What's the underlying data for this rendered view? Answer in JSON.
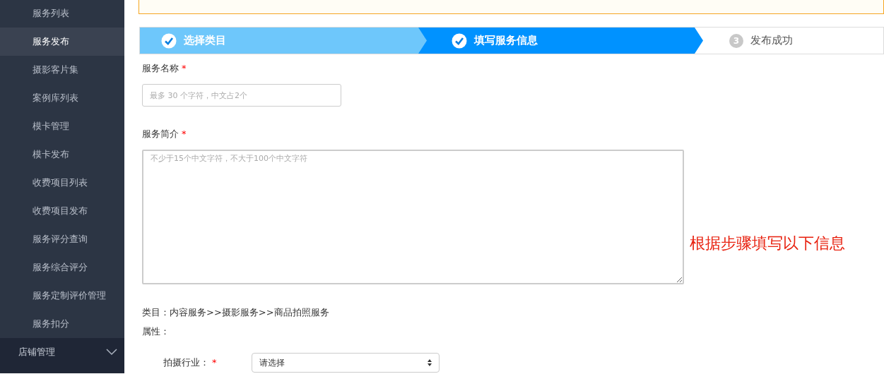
{
  "sidebar": {
    "items": [
      {
        "label": "服务列表",
        "selected": false
      },
      {
        "label": "服务发布",
        "selected": true
      },
      {
        "label": "摄影客片集",
        "selected": false
      },
      {
        "label": "案例库列表",
        "selected": false
      },
      {
        "label": "模卡管理",
        "selected": false
      },
      {
        "label": "模卡发布",
        "selected": false
      },
      {
        "label": "收费项目列表",
        "selected": false
      },
      {
        "label": "收费项目发布",
        "selected": false
      },
      {
        "label": "服务评分查询",
        "selected": false
      },
      {
        "label": "服务综合评分",
        "selected": false
      },
      {
        "label": "服务定制评价管理",
        "selected": false
      },
      {
        "label": "服务扣分",
        "selected": false
      }
    ],
    "groups": [
      {
        "label": "店铺管理",
        "expanded": false
      }
    ]
  },
  "steps": [
    {
      "label": "选择类目",
      "completed": true,
      "selected": false
    },
    {
      "label": "填写服务信息",
      "completed": true,
      "selected": true
    },
    {
      "label": "发布成功",
      "completed": false,
      "selected": false,
      "number": "3"
    }
  ],
  "form": {
    "name_field": {
      "label": "服务名称",
      "required_mark": "*",
      "placeholder": "最多 30 个字符，中文占2个"
    },
    "intro_field": {
      "label": "服务简介",
      "required_mark": "*",
      "placeholder": "不少于15个中文字符，不大于100个中文字符"
    },
    "category": "类目：内容服务>>摄影服务>>商品拍照服务",
    "attributes_label": "属性：",
    "industry_field": {
      "label": "拍摄行业：",
      "required_mark": "*",
      "value": "请选择"
    }
  },
  "annotation": "根据步骤填写以下信息"
}
